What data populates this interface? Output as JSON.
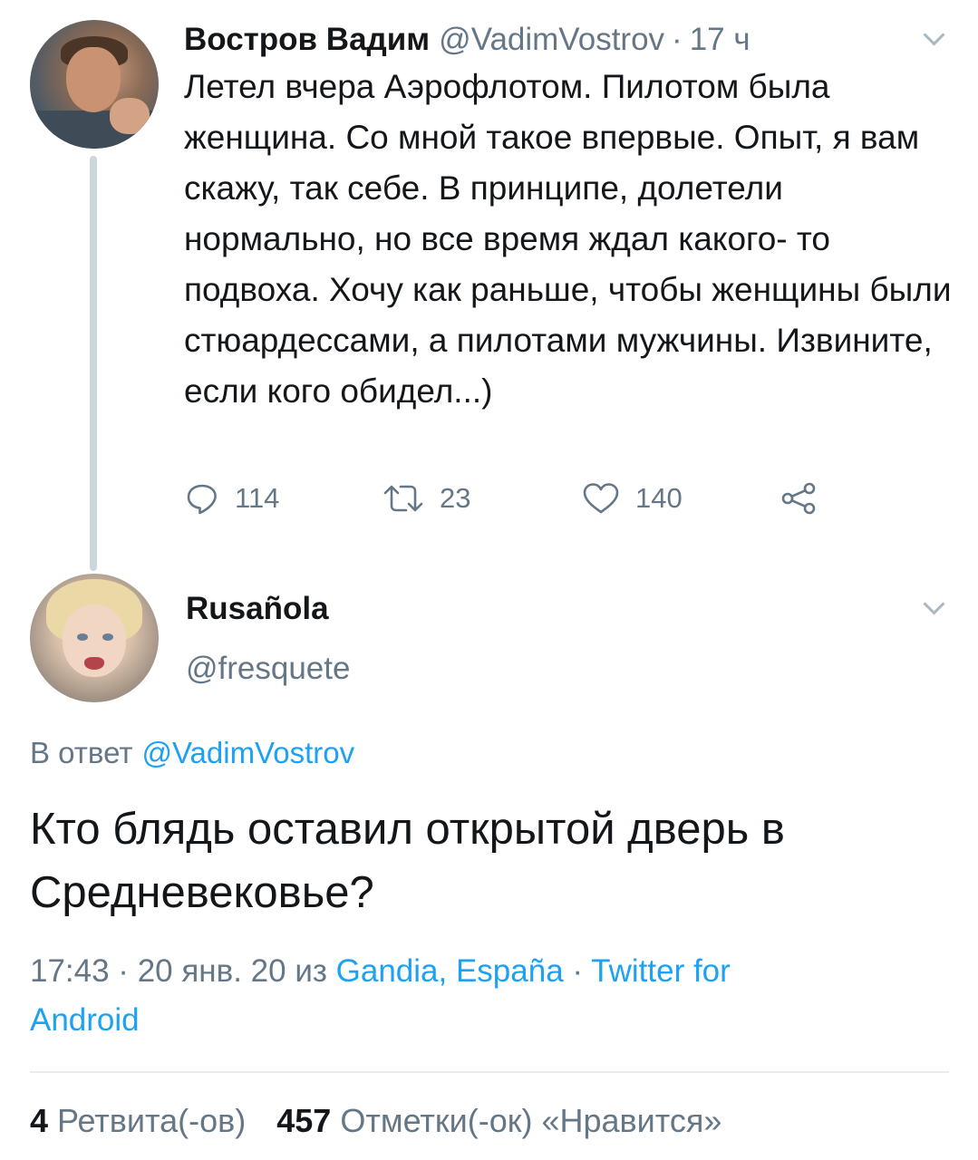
{
  "original_tweet": {
    "author_name": "Востров Вадим",
    "handle": "@VadimVostrov",
    "separator": "·",
    "time": "17 ч",
    "text": "Летел вчера Аэрофлотом. Пилотом была женщина. Со мной такое впервые. Опыт, я вам скажу, так себе. В принципе, долетели нормально, но все время ждал какого- то подвоха. Хочу как раньше, чтобы женщины были стюардессами, а пилотами мужчины. Извините, если кого обидел...)",
    "actions": {
      "reply_count": "114",
      "retweet_count": "23",
      "like_count": "140"
    }
  },
  "reply_tweet": {
    "author_name": "Rusañola",
    "handle": "@fresquete",
    "reply_prefix": "В ответ",
    "reply_mention": "@VadimVostrov",
    "text": "Кто блядь оставил открытой дверь в Средневековье?",
    "meta": {
      "time_date": "17:43 · 20 янв. 20 из",
      "location": "Gandia, España",
      "separator": "·",
      "client": "Twitter for Android"
    },
    "stats": {
      "retweets_count": "4",
      "retweets_label": "Ретвита(-ов)",
      "likes_count": "457",
      "likes_label": "Отметки(-ок) «Нравится»"
    }
  },
  "icons": [
    "reply-icon",
    "retweet-icon",
    "like-icon",
    "share-icon",
    "chevron-down-icon"
  ],
  "colors": {
    "text": "#14171a",
    "secondary": "#657786",
    "link": "#1da1f2",
    "thread_line": "#ccd6dd"
  }
}
